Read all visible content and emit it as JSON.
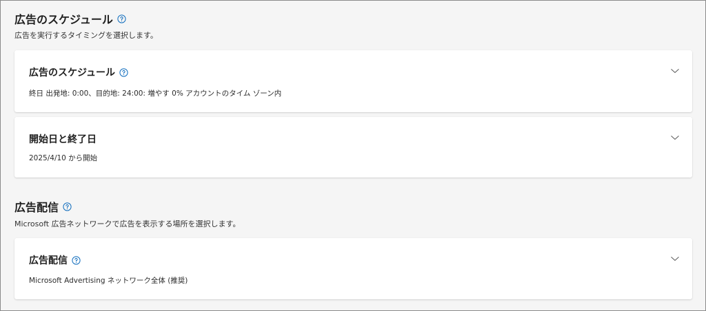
{
  "schedule_section": {
    "title": "広告のスケジュール",
    "subtitle": "広告を実行するタイミングを選択します。"
  },
  "schedule_card": {
    "title": "広告のスケジュール",
    "detail": "終日 出発地: 0:00、目的地: 24:00: 増やす 0% アカウントのタイム ゾーン内"
  },
  "dates_card": {
    "title": "開始日と終了日",
    "detail": "2025/4/10 から開始"
  },
  "delivery_section": {
    "title": "広告配信",
    "subtitle": "Microsoft 広告ネットワークで広告を表示する場所を選択します。"
  },
  "delivery_card": {
    "title": "広告配信",
    "detail": "Microsoft Advertising ネットワーク全体 (推奨)"
  },
  "icons": {
    "help": "question-circle-icon",
    "expand": "chevron-down-icon"
  },
  "colors": {
    "help_icon": "#0f6cbd",
    "background": "#f5f5f5",
    "card": "#ffffff"
  }
}
